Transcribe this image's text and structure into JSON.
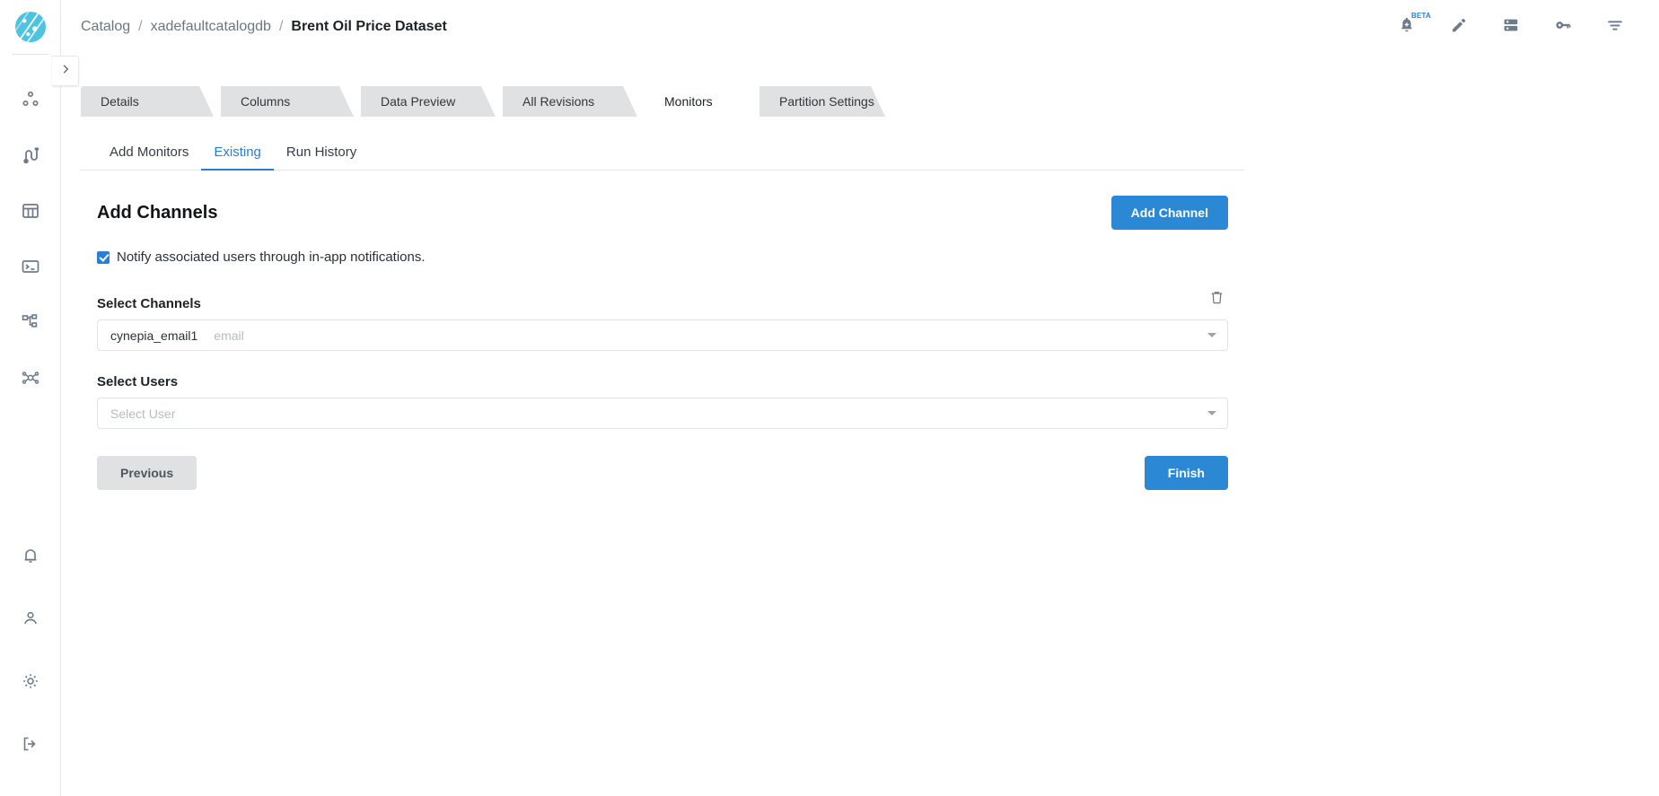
{
  "brand": {
    "logo_name": "app-logo",
    "accent": "#2a7fd4",
    "logo_color": "#4ec3e0"
  },
  "breadcrumb": {
    "items": [
      {
        "label": "Catalog",
        "current": false
      },
      {
        "label": "xadefaultcatalogdb",
        "current": false
      },
      {
        "label": "Brent Oil Price Dataset",
        "current": true
      }
    ],
    "separator": "/"
  },
  "topbar_actions": [
    {
      "name": "notification-add-icon",
      "badge": "BETA"
    },
    {
      "name": "edit-pencil-icon",
      "badge": ""
    },
    {
      "name": "database-icon",
      "badge": ""
    },
    {
      "name": "key-icon",
      "badge": ""
    },
    {
      "name": "filter-icon",
      "badge": ""
    }
  ],
  "rail": {
    "top_items": [
      {
        "name": "sidebar-item-clusters",
        "icon": "dots-nodes-icon"
      },
      {
        "name": "sidebar-item-pipelines",
        "icon": "pipeline-icon"
      },
      {
        "name": "sidebar-item-tables",
        "icon": "table-icon"
      },
      {
        "name": "sidebar-item-console",
        "icon": "terminal-icon"
      },
      {
        "name": "sidebar-item-workflows",
        "icon": "sitemap-icon"
      },
      {
        "name": "sidebar-item-lineage",
        "icon": "network-hub-icon"
      }
    ],
    "bottom_items": [
      {
        "name": "sidebar-item-alerts",
        "icon": "bell-icon"
      },
      {
        "name": "sidebar-item-profile",
        "icon": "user-icon"
      },
      {
        "name": "sidebar-item-settings",
        "icon": "gear-icon"
      },
      {
        "name": "sidebar-item-logout",
        "icon": "logout-icon"
      }
    ],
    "collapse_icon": "chevron-right-icon"
  },
  "tabs": [
    {
      "label": "Details",
      "active": false
    },
    {
      "label": "Columns",
      "active": false
    },
    {
      "label": "Data Preview",
      "active": false
    },
    {
      "label": "All Revisions",
      "active": false
    },
    {
      "label": "Monitors",
      "active": true
    },
    {
      "label": "Partition Settings",
      "active": false
    }
  ],
  "subtabs": [
    {
      "label": "Add Monitors",
      "active": false
    },
    {
      "label": "Existing",
      "active": true
    },
    {
      "label": "Run History",
      "active": false
    }
  ],
  "content": {
    "section_title": "Add Channels",
    "add_channel_label": "Add Channel",
    "notify_checkbox": {
      "label": "Notify associated users through in-app notifications.",
      "checked": true
    },
    "channels_field": {
      "label": "Select Channels",
      "value": "cynepia_email1",
      "placeholder": "email",
      "delete_icon": "trash-icon",
      "caret_icon": "chevron-down-icon"
    },
    "users_field": {
      "label": "Select Users",
      "value": "",
      "placeholder": "Select User",
      "caret_icon": "chevron-down-icon"
    },
    "previous_label": "Previous",
    "finish_label": "Finish"
  }
}
